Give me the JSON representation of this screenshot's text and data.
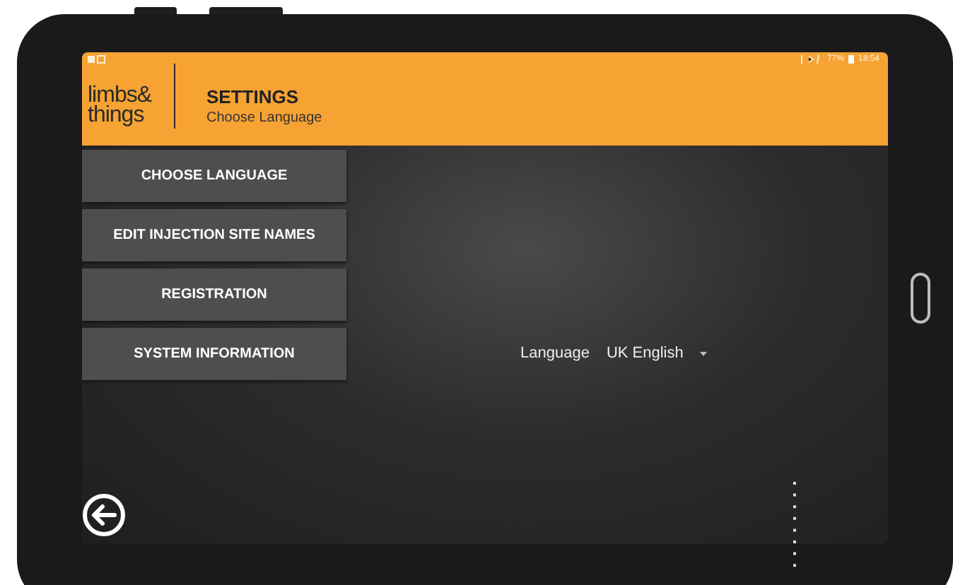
{
  "status_bar": {
    "battery": "77%",
    "time": "18:54"
  },
  "header": {
    "logo": [
      "limbs&",
      "things"
    ],
    "title": "SETTINGS",
    "subtitle": "Choose Language"
  },
  "menu": [
    {
      "label": "CHOOSE LANGUAGE"
    },
    {
      "label": "EDIT INJECTION SITE NAMES"
    },
    {
      "label": "REGISTRATION"
    },
    {
      "label": "SYSTEM INFORMATION"
    }
  ],
  "language": {
    "label": "Language",
    "value": "UK English"
  }
}
